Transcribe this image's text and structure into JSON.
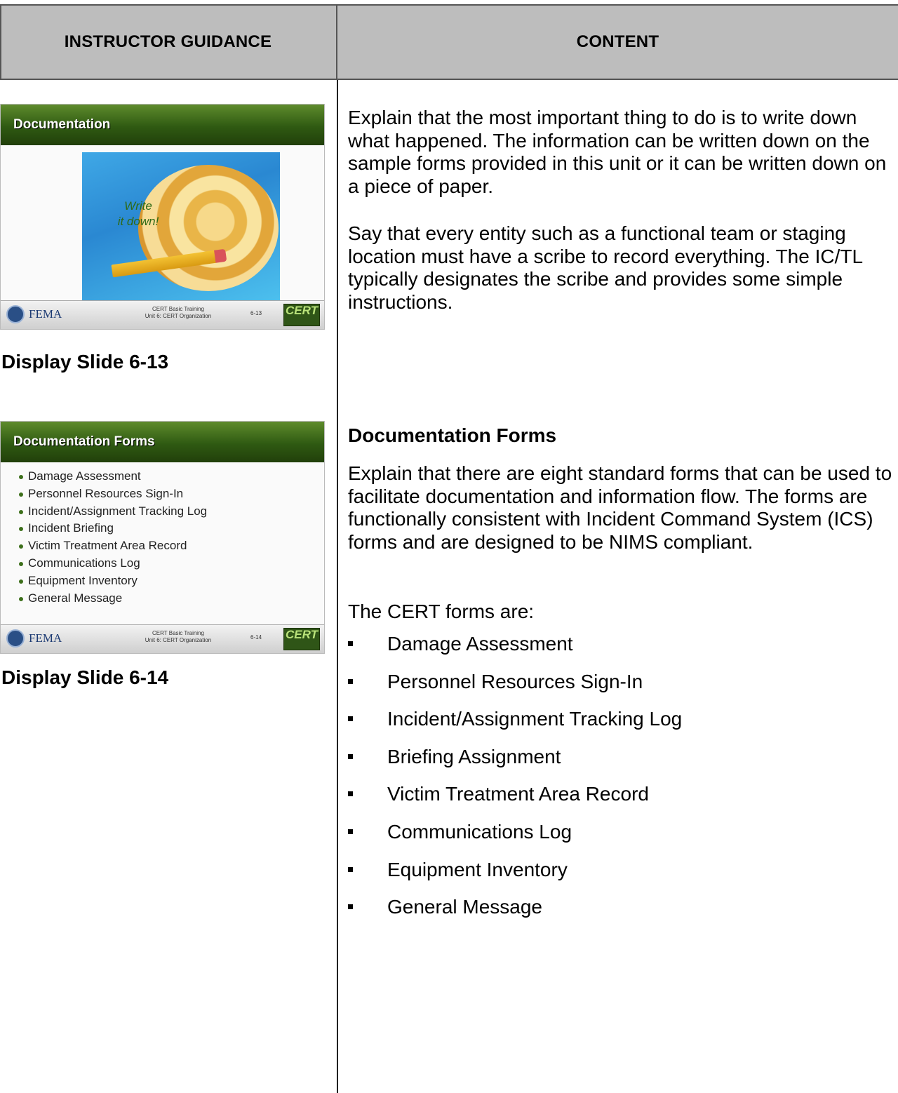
{
  "header": {
    "left_first": "I",
    "left_rest_1": "NSTRUCTOR ",
    "left_cap_2": "G",
    "left_rest_2": "UIDANCE",
    "right_first": "C",
    "right_rest": "ONTENT"
  },
  "slides": [
    {
      "title": "Documentation",
      "art_text_line1": "Write",
      "art_text_line2": "it down!",
      "footer_agency": "FEMA",
      "footer_line1": "CERT Basic Training",
      "footer_line2": "Unit 6: CERT Organization",
      "footer_number": "6-13",
      "logo": "CERT",
      "caption": "Display Slide 6-13"
    },
    {
      "title": "Documentation Forms",
      "items": [
        "Damage Assessment",
        "Personnel Resources Sign-In",
        "Incident/Assignment Tracking Log",
        "Incident Briefing",
        "Victim Treatment Area Record",
        "Communications Log",
        "Equipment Inventory",
        "General Message"
      ],
      "footer_agency": "FEMA",
      "footer_line1": "CERT Basic Training",
      "footer_line2": "Unit 6: CERT Organization",
      "footer_number": "6-14",
      "logo": "CERT",
      "caption": "Display Slide 6-14"
    }
  ],
  "content": {
    "p1": "Explain that the most important thing to do is to write down what happened.  The information can be written down on the sample forms provided in this unit or it can be written down on a piece of paper.",
    "p2": "Say that every entity such as a functional team or staging location must have a scribe to record everything. The IC/TL typically designates the scribe and provides some simple instructions.",
    "heading": "Documentation Forms",
    "p3": "Explain that there are eight standard forms that can be used to facilitate documentation and information flow. The forms are functionally consistent with Incident Command System (ICS) forms and are designed to be NIMS compliant.",
    "p4": "The CERT forms are:",
    "forms": [
      "Damage Assessment",
      "Personnel Resources Sign-In",
      "Incident/Assignment Tracking Log",
      "Briefing Assignment",
      "Victim Treatment Area Record",
      "Communications Log",
      "Equipment Inventory",
      "General Message"
    ]
  }
}
